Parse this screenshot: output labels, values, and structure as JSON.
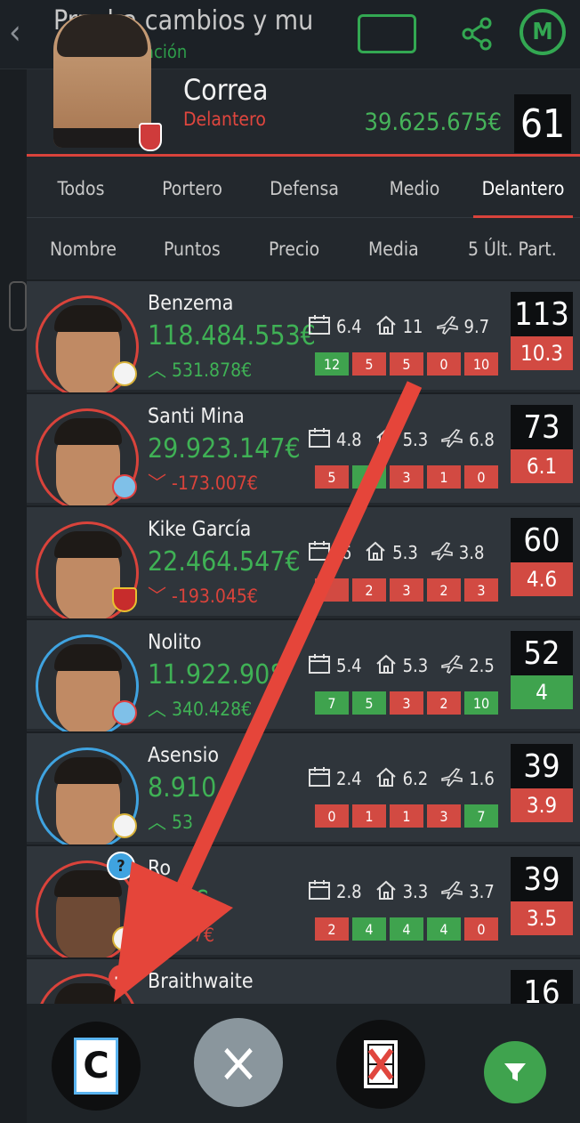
{
  "app": {
    "title": "Prueba cambios y mu",
    "subtitle": "ación",
    "logo_letter": "M"
  },
  "selected_player": {
    "name": "Correa",
    "position": "Delantero",
    "price": "39.625.675€",
    "points": "61"
  },
  "tabs": [
    {
      "label": "Todos"
    },
    {
      "label": "Portero"
    },
    {
      "label": "Defensa"
    },
    {
      "label": "Medio"
    },
    {
      "label": "Delantero",
      "active": true
    }
  ],
  "sort_columns": [
    {
      "label": "Nombre"
    },
    {
      "label": "Puntos"
    },
    {
      "label": "Precio"
    },
    {
      "label": "Media"
    },
    {
      "label": "5 Últ. Part."
    }
  ],
  "players": [
    {
      "name": "Benzema",
      "price": "118.484.553€",
      "delta": "531.878€",
      "trend": "up",
      "club": "Real Madrid",
      "stats": {
        "avg": "6.4",
        "home": "11",
        "away": "9.7"
      },
      "last5": [
        {
          "v": "12",
          "c": "g"
        },
        {
          "v": "5",
          "c": "r"
        },
        {
          "v": "5",
          "c": "r"
        },
        {
          "v": "0",
          "c": "r"
        },
        {
          "v": "10",
          "c": "r"
        }
      ],
      "points": "113",
      "average": "10.3",
      "average_color": "r",
      "ring": "red"
    },
    {
      "name": "Santi Mina",
      "price": "29.923.147€",
      "delta": "-173.007€",
      "trend": "down",
      "club": "Celta",
      "stats": {
        "avg": "4.8",
        "home": "5.3",
        "away": "6.8"
      },
      "last5": [
        {
          "v": "5",
          "c": "r"
        },
        {
          "v": "",
          "c": "g"
        },
        {
          "v": "3",
          "c": "r"
        },
        {
          "v": "1",
          "c": "r"
        },
        {
          "v": "0",
          "c": "r"
        }
      ],
      "points": "73",
      "average": "6.1",
      "average_color": "r",
      "ring": "red"
    },
    {
      "name": "Kike García",
      "price": "22.464.547€",
      "delta": "-193.045€",
      "trend": "down",
      "club": "Osasuna",
      "stats": {
        "avg": ".6",
        "home": "5.3",
        "away": "3.8"
      },
      "last5": [
        {
          "v": "",
          "c": "r"
        },
        {
          "v": "2",
          "c": "r"
        },
        {
          "v": "3",
          "c": "r"
        },
        {
          "v": "2",
          "c": "r"
        },
        {
          "v": "3",
          "c": "r"
        }
      ],
      "points": "60",
      "average": "4.6",
      "average_color": "r",
      "ring": "red"
    },
    {
      "name": "Nolito",
      "price": "11.922.908",
      "delta": "340.428€",
      "trend": "up",
      "club": "Celta",
      "stats": {
        "avg": "5.4",
        "home": "5.3",
        "away": "2.5"
      },
      "last5": [
        {
          "v": "7",
          "c": "g"
        },
        {
          "v": "5",
          "c": "g"
        },
        {
          "v": "3",
          "c": "r"
        },
        {
          "v": "2",
          "c": "r"
        },
        {
          "v": "10",
          "c": "g"
        }
      ],
      "points": "52",
      "average": "4",
      "average_color": "g",
      "ring": "blue"
    },
    {
      "name": "Asensio",
      "price": "8.910",
      "delta": "53",
      "trend": "up",
      "club": "Real Madrid",
      "stats": {
        "avg": "2.4",
        "home": "6.2",
        "away": "1.6"
      },
      "last5": [
        {
          "v": "0",
          "c": "r"
        },
        {
          "v": "1",
          "c": "r"
        },
        {
          "v": "1",
          "c": "r"
        },
        {
          "v": "3",
          "c": "r"
        },
        {
          "v": "7",
          "c": "g"
        }
      ],
      "points": "39",
      "average": "3.9",
      "average_color": "r",
      "ring": "blue"
    },
    {
      "name": "Ro",
      "name_tail": "o",
      "price": "442€",
      "delta": "527€",
      "trend": "down",
      "club": "Real Madrid",
      "stats": {
        "avg": "2.8",
        "home": "3.3",
        "away": "3.7"
      },
      "last5": [
        {
          "v": "2",
          "c": "r"
        },
        {
          "v": "4",
          "c": "g"
        },
        {
          "v": "4",
          "c": "g"
        },
        {
          "v": "4",
          "c": "g"
        },
        {
          "v": "0",
          "c": "r"
        }
      ],
      "points": "39",
      "average": "3.5",
      "average_color": "r",
      "ring": "red",
      "question": "?"
    },
    {
      "name": "Braithwaite",
      "price": "",
      "delta": "",
      "trend": "up",
      "club": "",
      "stats": {
        "avg": "",
        "home": "",
        "away": ""
      },
      "last5": [],
      "points": "16",
      "average": "",
      "average_color": "r",
      "ring": "red",
      "plus": "+"
    }
  ],
  "bottom_bar": {
    "captain_letter": "C",
    "close_symbol": "×"
  }
}
